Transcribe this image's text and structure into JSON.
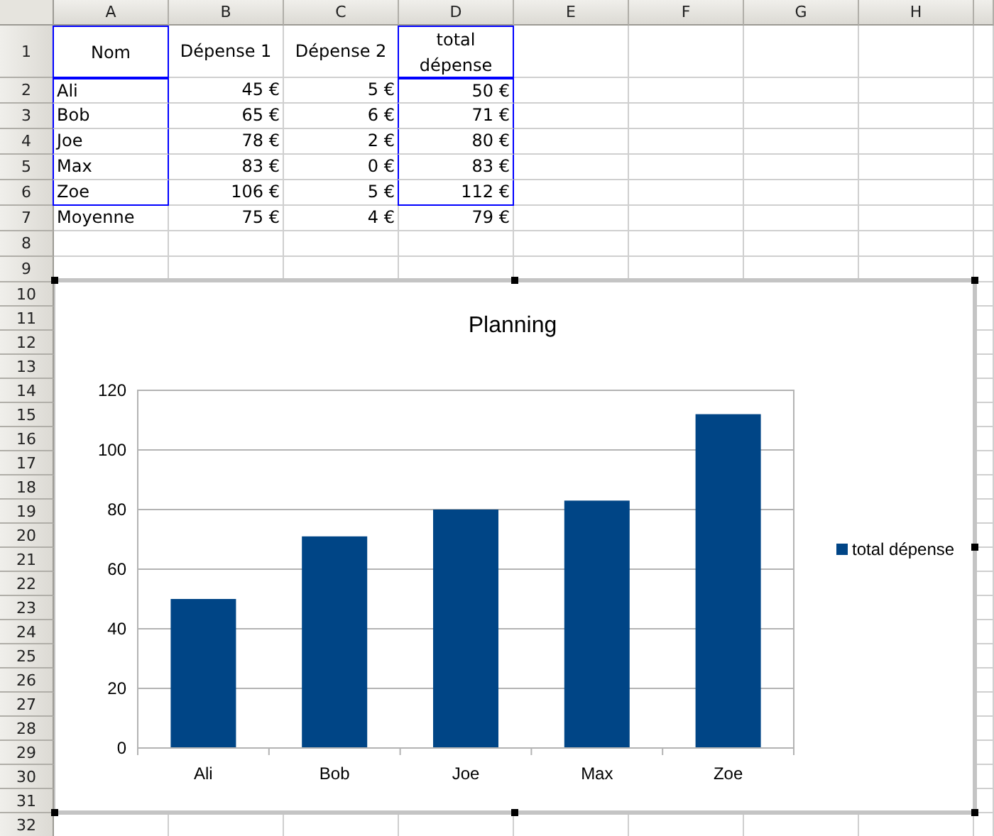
{
  "sheet": {
    "columns": [
      {
        "label": "A",
        "kind": "text"
      },
      {
        "label": "B",
        "kind": "number"
      },
      {
        "label": "C",
        "kind": "number"
      },
      {
        "label": "D",
        "kind": "number"
      },
      {
        "label": "E",
        "kind": "text"
      },
      {
        "label": "F",
        "kind": "text"
      },
      {
        "label": "G",
        "kind": "text"
      },
      {
        "label": "H",
        "kind": "text"
      }
    ],
    "rows": [
      {
        "number": "1",
        "kind": "header",
        "cells": [
          {
            "text": "Nom",
            "in_chart_range": true
          },
          {
            "text": "Dépense 1",
            "in_chart_range": false
          },
          {
            "text": "Dépense 2",
            "in_chart_range": false
          },
          {
            "text": "total dépense",
            "in_chart_range": true
          }
        ]
      },
      {
        "number": "2",
        "kind": "data",
        "cells": [
          {
            "text": "Ali",
            "in_chart_range": true
          },
          {
            "text": "45 €",
            "in_chart_range": false
          },
          {
            "text": "5 €",
            "in_chart_range": false
          },
          {
            "text": "50 €",
            "in_chart_range": true
          }
        ]
      },
      {
        "number": "3",
        "kind": "data",
        "cells": [
          {
            "text": "Bob",
            "in_chart_range": true
          },
          {
            "text": "65 €",
            "in_chart_range": false
          },
          {
            "text": "6 €",
            "in_chart_range": false
          },
          {
            "text": "71 €",
            "in_chart_range": true
          }
        ]
      },
      {
        "number": "4",
        "kind": "data",
        "cells": [
          {
            "text": "Joe",
            "in_chart_range": true
          },
          {
            "text": "78 €",
            "in_chart_range": false
          },
          {
            "text": "2 €",
            "in_chart_range": false
          },
          {
            "text": "80 €",
            "in_chart_range": true
          }
        ]
      },
      {
        "number": "5",
        "kind": "data",
        "cells": [
          {
            "text": "Max",
            "in_chart_range": true
          },
          {
            "text": "83 €",
            "in_chart_range": false
          },
          {
            "text": "0 €",
            "in_chart_range": false
          },
          {
            "text": "83 €",
            "in_chart_range": true
          }
        ]
      },
      {
        "number": "6",
        "kind": "data",
        "cells": [
          {
            "text": "Zoe",
            "in_chart_range": true
          },
          {
            "text": "106 €",
            "in_chart_range": false
          },
          {
            "text": "5 €",
            "in_chart_range": false
          },
          {
            "text": "112 €",
            "in_chart_range": true
          }
        ]
      },
      {
        "number": "7",
        "kind": "data",
        "cells": [
          {
            "text": "Moyenne",
            "in_chart_range": false
          },
          {
            "text": "75 €",
            "in_chart_range": false
          },
          {
            "text": "4 €",
            "in_chart_range": false
          },
          {
            "text": "79 €",
            "in_chart_range": false
          }
        ]
      },
      {
        "number": "8",
        "kind": "data"
      },
      {
        "number": "9",
        "kind": "data"
      },
      {
        "number": "10",
        "kind": "data"
      },
      {
        "number": "11",
        "kind": "data"
      },
      {
        "number": "12",
        "kind": "data"
      },
      {
        "number": "13",
        "kind": "data"
      },
      {
        "number": "14",
        "kind": "data"
      },
      {
        "number": "15",
        "kind": "data"
      },
      {
        "number": "16",
        "kind": "data"
      },
      {
        "number": "17",
        "kind": "data"
      },
      {
        "number": "18",
        "kind": "data"
      },
      {
        "number": "19",
        "kind": "data"
      },
      {
        "number": "20",
        "kind": "data"
      },
      {
        "number": "21",
        "kind": "data"
      },
      {
        "number": "22",
        "kind": "data"
      },
      {
        "number": "23",
        "kind": "data"
      },
      {
        "number": "24",
        "kind": "data"
      },
      {
        "number": "25",
        "kind": "data"
      },
      {
        "number": "26",
        "kind": "data"
      },
      {
        "number": "27",
        "kind": "data"
      },
      {
        "number": "28",
        "kind": "data"
      },
      {
        "number": "29",
        "kind": "data"
      },
      {
        "number": "30",
        "kind": "data"
      },
      {
        "number": "31",
        "kind": "data"
      },
      {
        "number": "32",
        "kind": "data"
      }
    ]
  },
  "chart": {
    "chart_data": {
      "type": "bar",
      "title": "Planning",
      "categories": [
        "Ali",
        "Bob",
        "Joe",
        "Max",
        "Zoe"
      ],
      "series": [
        {
          "name": "total dépense",
          "color": "#004586",
          "values": [
            50,
            71,
            80,
            83,
            112
          ]
        }
      ],
      "ylim": [
        0,
        120
      ],
      "yticks": [
        0,
        20,
        40,
        60,
        80,
        100,
        120
      ],
      "grid": true
    }
  }
}
